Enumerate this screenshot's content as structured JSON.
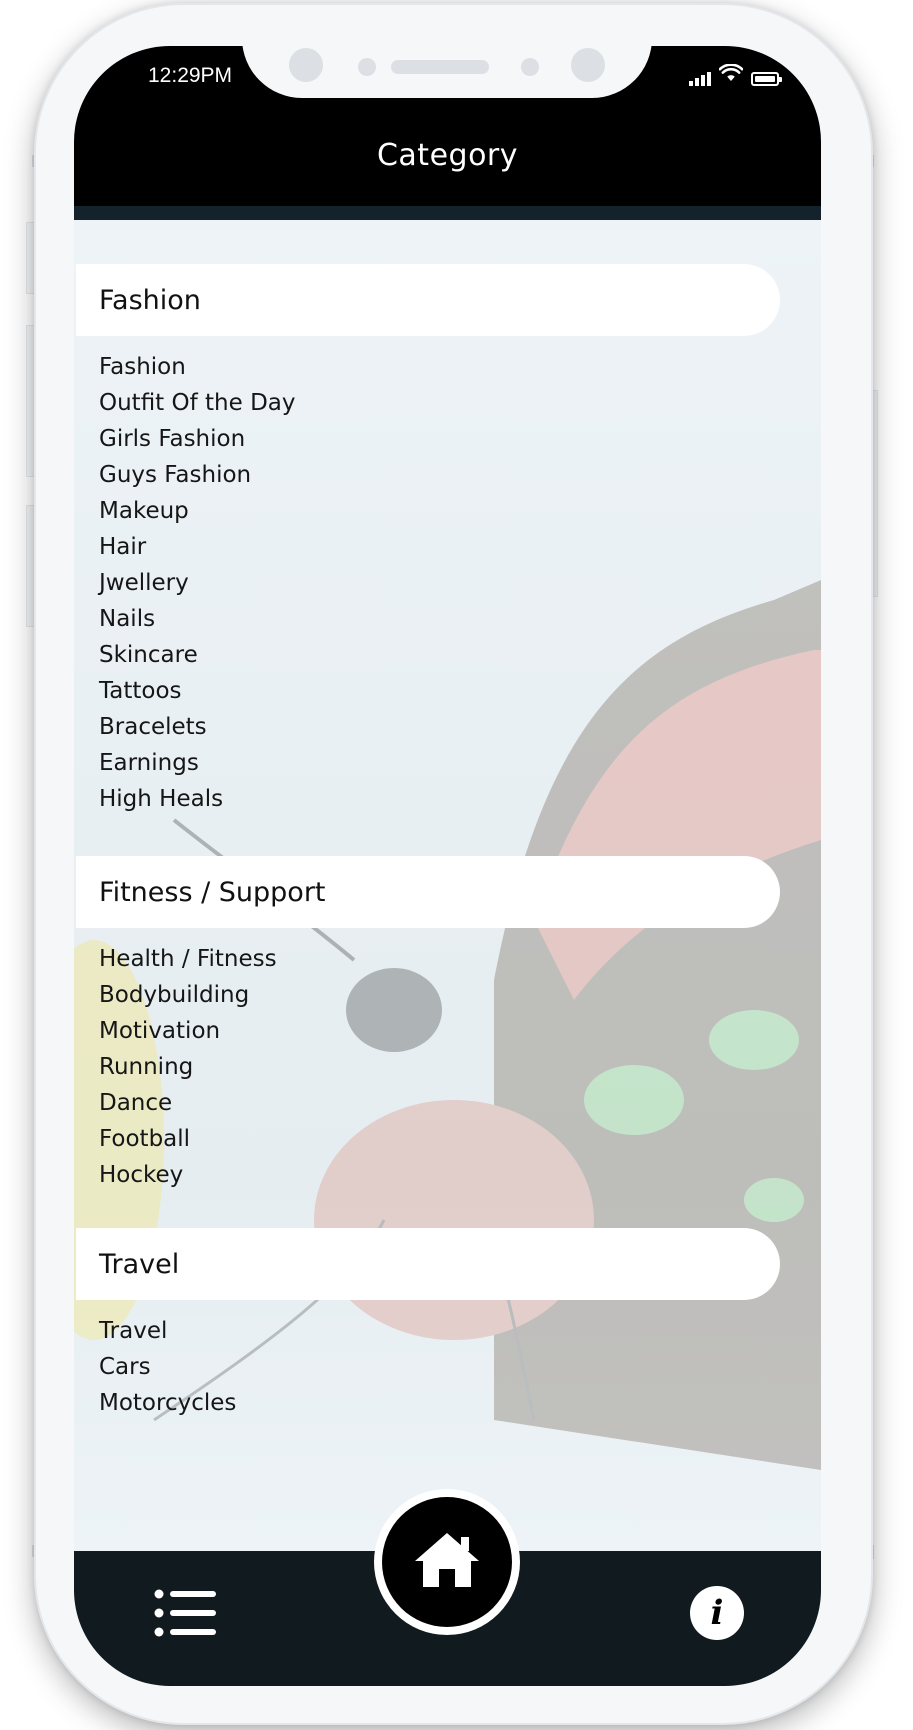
{
  "status_bar": {
    "time": "12:29PM",
    "icons": [
      "signal-icon",
      "wifi-icon",
      "battery-icon"
    ]
  },
  "header": {
    "title": "Category"
  },
  "sections": [
    {
      "title": "Fashion",
      "items": [
        "Fashion",
        "Outfit Of the Day",
        "Girls Fashion",
        "Guys Fashion",
        "Makeup",
        "Hair",
        "Jwellery",
        "Nails",
        "Skincare",
        "Tattoos",
        "Bracelets",
        "Earnings",
        "High Heals"
      ]
    },
    {
      "title": "Fitness / Support",
      "items": [
        "Health / Fitness",
        "Bodybuilding",
        "Motivation",
        "Running",
        "Dance",
        "Football",
        "Hockey"
      ]
    },
    {
      "title": "Travel",
      "items": [
        "Travel",
        "Cars",
        "Motorcycles"
      ]
    }
  ],
  "bottom_nav": {
    "left_icon": "menu-list-icon",
    "center_icon": "home-icon",
    "right_icon": "info-icon",
    "info_glyph": "i"
  },
  "colors": {
    "header_bg": "#000000",
    "nav_bg": "#111a1f",
    "section_header_bg": "#ffffff",
    "text": "#161616"
  }
}
